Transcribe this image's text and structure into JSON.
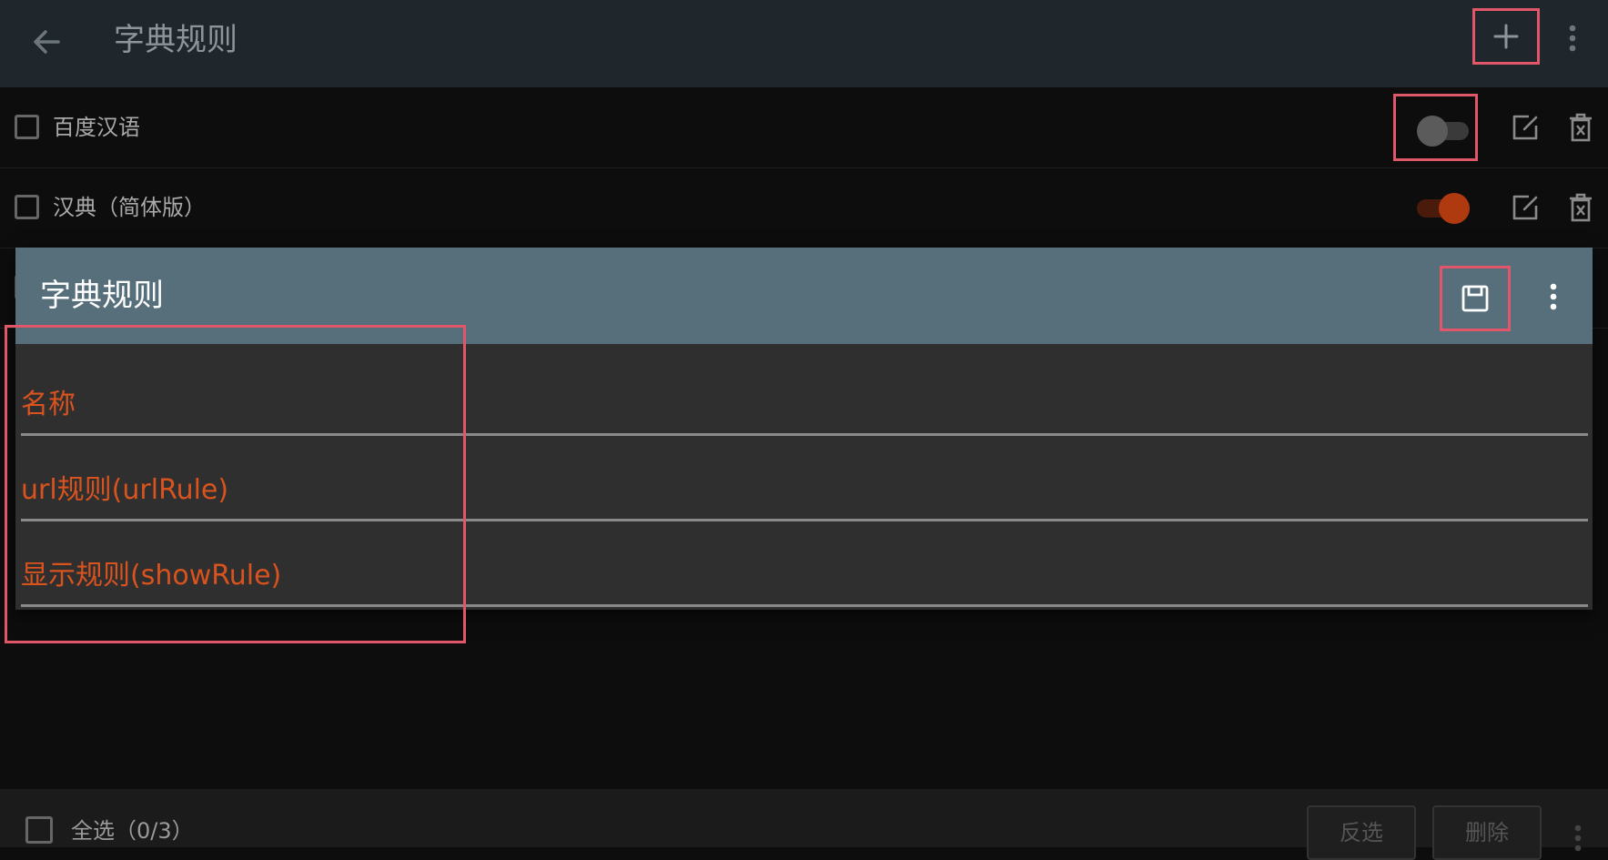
{
  "appbar": {
    "title": "字典规则",
    "back_icon": "arrow-left-icon",
    "add_icon": "plus-icon",
    "more_icon": "more-vertical-icon"
  },
  "rules": [
    {
      "name": "百度汉语",
      "enabled": false
    },
    {
      "name": "汉典（简体版）",
      "enabled": true
    },
    {
      "name": "",
      "enabled": false
    }
  ],
  "dialog": {
    "title": "字典规则",
    "save_icon": "save-icon",
    "more_icon": "more-vertical-icon",
    "fields": [
      {
        "label": "名称",
        "value": ""
      },
      {
        "label": "url规则(urlRule)",
        "value": ""
      },
      {
        "label": "显示规则(showRule)",
        "value": ""
      }
    ]
  },
  "bottombar": {
    "select_all_label": "全选（0/3）",
    "invert_label": "反选",
    "delete_label": "删除"
  },
  "colors": {
    "accent": "#d9531e",
    "highlight": "#e2566a",
    "dialog_header": "#566f7b",
    "appbar": "#1f272d",
    "switch_off": "#555555",
    "switch_on": "#b03a10"
  }
}
